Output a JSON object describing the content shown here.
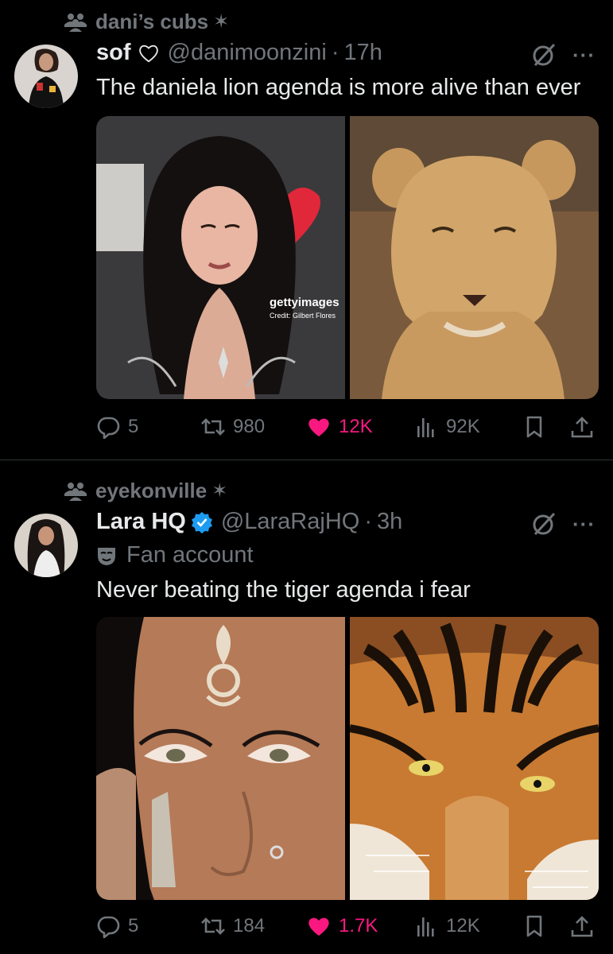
{
  "colors": {
    "background": "#000000",
    "text": "#e7e9ea",
    "muted": "#71767b",
    "like": "#f91880",
    "verified": "#1d9bf0",
    "divider": "#2f3336"
  },
  "tweets": [
    {
      "community": "dani’s cubs",
      "community_star": "✶",
      "name": "sof",
      "handle": "@danimoonzini",
      "dot": "·",
      "time": "17h",
      "text": "The daniela lion agenda is more alive than ever",
      "watermark_brand": "gettyimages",
      "watermark_credit": "Credit: Gilbert Flores",
      "stats": {
        "replies": "5",
        "reposts": "980",
        "likes": "12K",
        "views": "92K"
      },
      "icons": [
        "community-icon",
        "heart-outline-icon",
        "grok-icon",
        "more-icon",
        "reply-icon",
        "repost-icon",
        "like-icon",
        "views-icon",
        "bookmark-icon",
        "share-icon"
      ]
    },
    {
      "community": "eyekonville",
      "community_star": "✶",
      "name": "Lara HQ",
      "handle": "@LaraRajHQ",
      "dot": "·",
      "time": "3h",
      "badge": "Fan account",
      "text": "Never beating the tiger agenda i fear",
      "stats": {
        "replies": "5",
        "reposts": "184",
        "likes": "1.7K",
        "views": "12K"
      },
      "icons": [
        "community-icon",
        "verified-icon",
        "fan-mask-icon",
        "grok-icon",
        "more-icon",
        "reply-icon",
        "repost-icon",
        "like-icon",
        "views-icon",
        "bookmark-icon",
        "share-icon"
      ]
    }
  ],
  "more_label": "···"
}
